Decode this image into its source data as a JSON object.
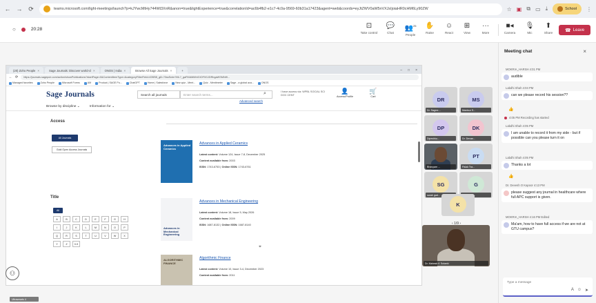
{
  "browser": {
    "url": "teams.microsoft.com/light-meetings/launch?p=kJYwcMtHy744Wt3XnR&anon=true&lightExperience=true&correlationId=ac6b4fb2-e1c7-4c0a-9569-60b31a17423&agent=web&coords=eyJtZWV0aW5nVXJsIjoiaHR0cHM6Ly90ZW",
    "profile_label": "School",
    "colors": {
      "accent": "#5b5fc7",
      "leave": "#c4314b"
    }
  },
  "meeting": {
    "time": "20:28",
    "controls": [
      {
        "label": "Take control",
        "icon": "take-control-icon"
      },
      {
        "label": "Chat",
        "icon": "chat-icon"
      },
      {
        "label": "People",
        "icon": "people-icon",
        "count": "25"
      },
      {
        "label": "Raise",
        "icon": "raise-hand-icon"
      },
      {
        "label": "React",
        "icon": "react-icon"
      },
      {
        "label": "View",
        "icon": "view-icon"
      },
      {
        "label": "More",
        "icon": "more-icon"
      },
      {
        "label": "Camera",
        "icon": "camera-icon"
      },
      {
        "label": "Mic",
        "icon": "mic-icon"
      },
      {
        "label": "Share",
        "icon": "share-icon"
      }
    ],
    "leave_label": "Leave"
  },
  "shared_screen": {
    "tabs": [
      {
        "label": "(20) Zoho People"
      },
      {
        "label": "Sage Journals: Discover world-cl"
      },
      {
        "label": "ONOS | India"
      },
      {
        "label": "Browse All Sage Journals",
        "active": true
      }
    ],
    "inner_url": "https://journals.sagepub.com/action/showPublications?startPage=0&ContentItemType=&categoryFilterField=lOBSB_g8=?0ssSctm?ML?_gaFMAMMhIGIOF0GJDRbgaWSMNt9...",
    "bookmarks": [
      "Managed favorites",
      "Zoho People",
      "Microsoft Forms",
      "AM",
      "Product | SAGE Pu...",
      "ChatGPT",
      "Home | Salesforce",
      "New quiz - Ment...",
      "Quiz - Mentimeter",
      "Sage - a global aca...",
      "ONOS"
    ],
    "site": {
      "logo": "Sage Journals",
      "search_scope": "Search all journals",
      "search_placeholder": "Enter search terms...",
      "advanced_search": "Advanced search",
      "access_text": "I have access via: WPBL SOCIAL SCI DOC CENT",
      "account_label": "Access/Profile",
      "cart_label": "Cart",
      "nav": [
        "Browse by discipline",
        "Information for"
      ],
      "facets": {
        "access_title": "Access",
        "all_journals": "All Journals",
        "open_access": "Gold Open Access Journals",
        "title_heading": "Title",
        "all_label": "All",
        "letters": [
          "A",
          "B",
          "C",
          "D",
          "E",
          "F",
          "G",
          "H",
          "I",
          "J",
          "K",
          "L",
          "M",
          "N",
          "O",
          "P",
          "Q",
          "R",
          "S",
          "T",
          "U",
          "V",
          "W",
          "X",
          "Y",
          "Z",
          "0-9"
        ]
      },
      "journals": [
        {
          "title": "Advances in Applied Ceramics",
          "cover_text": "Advances in Applied Ceramics",
          "latest_label": "Latest content:",
          "latest": "Volume 124, Issue 7-8, December 2025",
          "available_label": "Content available from:",
          "available": "2003",
          "issn_label": "ISSN:",
          "issn": "1743-6753",
          "online_label": "Online ISSN:",
          "online": "1743-6761",
          "cover_bg": "#1f6fb0",
          "cover_fg": "#ffffff"
        },
        {
          "title": "Advances in Mechanical Engineering",
          "cover_text": "Advances in Mechanical Engineering",
          "latest_label": "Latest content:",
          "latest": "Volume 18, Issue 5, May 2026",
          "available_label": "Content available from:",
          "available": "2009",
          "issn_label": "ISSN:",
          "issn": "1687-8132",
          "online_label": "Online ISSN:",
          "online": "1687-8140",
          "cover_bg": "#f3f4f6",
          "cover_fg": "#1e3a6e"
        },
        {
          "title": "Algorithmic Finance",
          "cover_text": "ALGORITHMIC FINANCE",
          "latest_label": "Latest content:",
          "latest": "Volume 10, Issue 3-4, December 2023",
          "available_label": "Content available from:",
          "available": "2011",
          "issn_label": "ISSN:",
          "issn": "",
          "online_label": "Online ISSN:",
          "online": "",
          "cover_bg": "#c9c2b0",
          "cover_fg": "#4a3d2a"
        }
      ]
    }
  },
  "participants": [
    {
      "initials": "DR",
      "name": "Dr. Sagrra ...",
      "color": "#c9cbee"
    },
    {
      "initials": "MS",
      "name": "Manisur S...",
      "color": "#c9cbee"
    },
    {
      "initials": "DP",
      "name": "Dipeshku...",
      "color": "#d3c7ee"
    },
    {
      "initials": "DK",
      "name": "Dr. Devan...",
      "color": "#f2c4cf"
    },
    {
      "initials": "",
      "name": "Bhavyam ...",
      "video": true
    },
    {
      "initials": "PT",
      "name": "Palak Tra...",
      "color": "#c9dcf2"
    },
    {
      "initials": "SG",
      "name": "sarah gad...",
      "color": "#f4e2a8"
    },
    {
      "initials": "G",
      "name": "GMNIT_H...",
      "color": "#cfe8d6"
    },
    {
      "initials": "K",
      "name": "",
      "color": "#f4e2a8"
    }
  ],
  "participants_pager": "1/9",
  "main_video_name": "Dr. Mahesh K Solanki",
  "chat": {
    "title": "Meeting chat",
    "input_placeholder": "Type a message",
    "messages": [
      {
        "meta": "MOKRIA_HARSH 4:01 PM",
        "text": "audible"
      },
      {
        "meta": "Labdhi Shah 4:04 PM",
        "text": "can we please record his session??"
      },
      {
        "emoji": "👍"
      },
      {
        "system": "4:05 PM   Recording has started"
      },
      {
        "meta": "Labdhi Shah 4:05 PM",
        "text": "I am unable to record it from my side - but if possible can you please turn it on"
      },
      {
        "meta": "Labdhi Shah 4:05 PM",
        "text": "Thanks a lot"
      },
      {
        "emoji": "👍"
      },
      {
        "meta": "Dr. Devesh O Kapoor 4:13 PM",
        "text": "please suggest any journal in healthcare where full APC support is given."
      },
      {
        "meta": "MOKRIA_HARSH 4:16 PM Edited",
        "text": "Ma'am, how to have full access if we are not at GTU campus?"
      }
    ]
  },
  "bottom_chip": "Ultrasmarts 4"
}
